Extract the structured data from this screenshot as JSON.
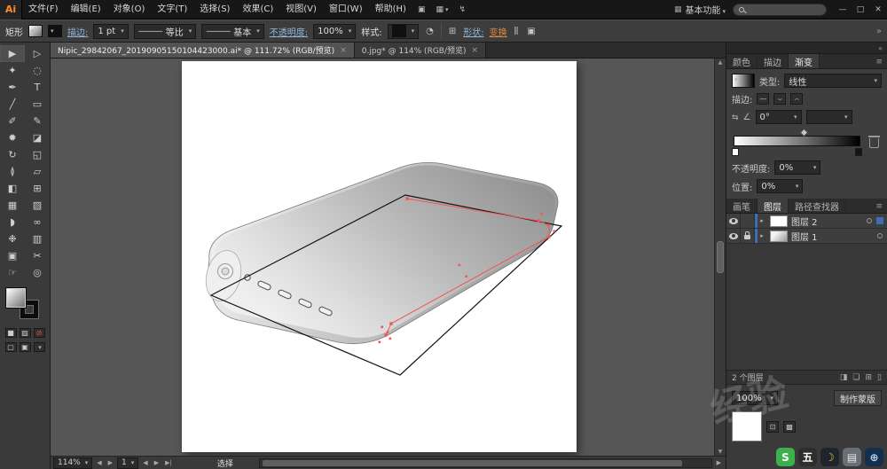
{
  "menubar": {
    "logo": "Ai",
    "items": [
      "文件(F)",
      "编辑(E)",
      "对象(O)",
      "文字(T)",
      "选择(S)",
      "效果(C)",
      "视图(V)",
      "窗口(W)",
      "帮助(H)"
    ],
    "extra_icons": [
      {
        "name": "grid-icon",
        "glyph": "▣"
      },
      {
        "name": "arrange-documents-icon",
        "glyph": "▦"
      },
      {
        "name": "cs-live-icon",
        "glyph": "↯"
      }
    ],
    "workspace": "基本功能"
  },
  "controlbar": {
    "selection_label": "矩形",
    "stroke_link": "描边:",
    "stroke_weight": "1 pt",
    "profile": "等比",
    "brush": "基本",
    "opacity_link": "不透明度:",
    "opacity_value": "100%",
    "style_label": "样式:",
    "shape_link": "形状:",
    "transform_link": "变换"
  },
  "tabs": [
    {
      "title": "Nipic_29842067_20190905150104423000.ai* @ 111.72% (RGB/预览)",
      "close": "×"
    },
    {
      "title": "0.jpg* @ 114% (RGB/预览)",
      "close": "×"
    }
  ],
  "tools": [
    {
      "name": "selection-tool",
      "glyph": "▶"
    },
    {
      "name": "direct-selection-tool",
      "glyph": "▷"
    },
    {
      "name": "magic-wand-tool",
      "glyph": "✦"
    },
    {
      "name": "lasso-tool",
      "glyph": "◌"
    },
    {
      "name": "pen-tool",
      "glyph": "✒"
    },
    {
      "name": "type-tool",
      "glyph": "T"
    },
    {
      "name": "line-segment-tool",
      "glyph": "╱"
    },
    {
      "name": "rectangle-tool",
      "glyph": "▭"
    },
    {
      "name": "paintbrush-tool",
      "glyph": "✐"
    },
    {
      "name": "pencil-tool",
      "glyph": "✎"
    },
    {
      "name": "blob-brush-tool",
      "glyph": "✹"
    },
    {
      "name": "eraser-tool",
      "glyph": "◪"
    },
    {
      "name": "rotate-tool",
      "glyph": "↻"
    },
    {
      "name": "scale-tool",
      "glyph": "◱"
    },
    {
      "name": "width-tool",
      "glyph": "≬"
    },
    {
      "name": "free-transform-tool",
      "glyph": "▱"
    },
    {
      "name": "shape-builder-tool",
      "glyph": "◧"
    },
    {
      "name": "perspective-grid-tool",
      "glyph": "⊞"
    },
    {
      "name": "mesh-tool",
      "glyph": "▦"
    },
    {
      "name": "gradient-tool",
      "glyph": "▨"
    },
    {
      "name": "eyedropper-tool",
      "glyph": "◗"
    },
    {
      "name": "blend-tool",
      "glyph": "∞"
    },
    {
      "name": "symbol-sprayer-tool",
      "glyph": "❉"
    },
    {
      "name": "column-graph-tool",
      "glyph": "▥"
    },
    {
      "name": "artboard-tool",
      "glyph": "▣"
    },
    {
      "name": "slice-tool",
      "glyph": "✂"
    },
    {
      "name": "hand-tool",
      "glyph": "☞"
    },
    {
      "name": "zoom-tool",
      "glyph": "◎"
    }
  ],
  "gradient_panel": {
    "tabs": [
      "颜色",
      "描边",
      "渐变"
    ],
    "type_label": "类型:",
    "type_value": "线性",
    "stroke_label": "描边:",
    "angle_value": "0°",
    "aspect_value": "",
    "opacity_label": "不透明度:",
    "opacity_value": "0%",
    "location_label": "位置:",
    "location_value": "0%"
  },
  "layers_panel": {
    "tabs": [
      "画笔",
      "图层",
      "路径查找器"
    ],
    "rows": [
      {
        "name": "图层 2"
      },
      {
        "name": "图层 1"
      }
    ],
    "count": "2 个图层"
  },
  "transparency_panel": {
    "opacity_value": "100%",
    "make_mask": "制作蒙版"
  },
  "statusbar": {
    "zoom": "114%",
    "frame": "1",
    "tool_status": "选择"
  },
  "watermark": {
    "text": "经验",
    "icons": [
      {
        "name": "watermark-icon-s",
        "glyph": "S",
        "bg": "#3cb04a",
        "color": "#ffffff"
      },
      {
        "name": "watermark-icon-wu",
        "glyph": "五",
        "bg": "#2e2e2e",
        "color": "#ffffff"
      },
      {
        "name": "watermark-icon-moon",
        "glyph": "☽",
        "bg": "#20242c",
        "color": "#f6c63f"
      },
      {
        "name": "watermark-icon-keyboard",
        "glyph": "▤",
        "bg": "#6a6f76",
        "color": "#e8e8e8"
      },
      {
        "name": "watermark-icon-globe",
        "glyph": "⊕",
        "bg": "#15304e",
        "color": "#bcd6ef"
      }
    ]
  },
  "colors": {
    "accent_blue": "#3f6fae",
    "link_blue": "#8fb7d8",
    "link_orange": "#e0873c",
    "selection_red": "#f25555"
  }
}
